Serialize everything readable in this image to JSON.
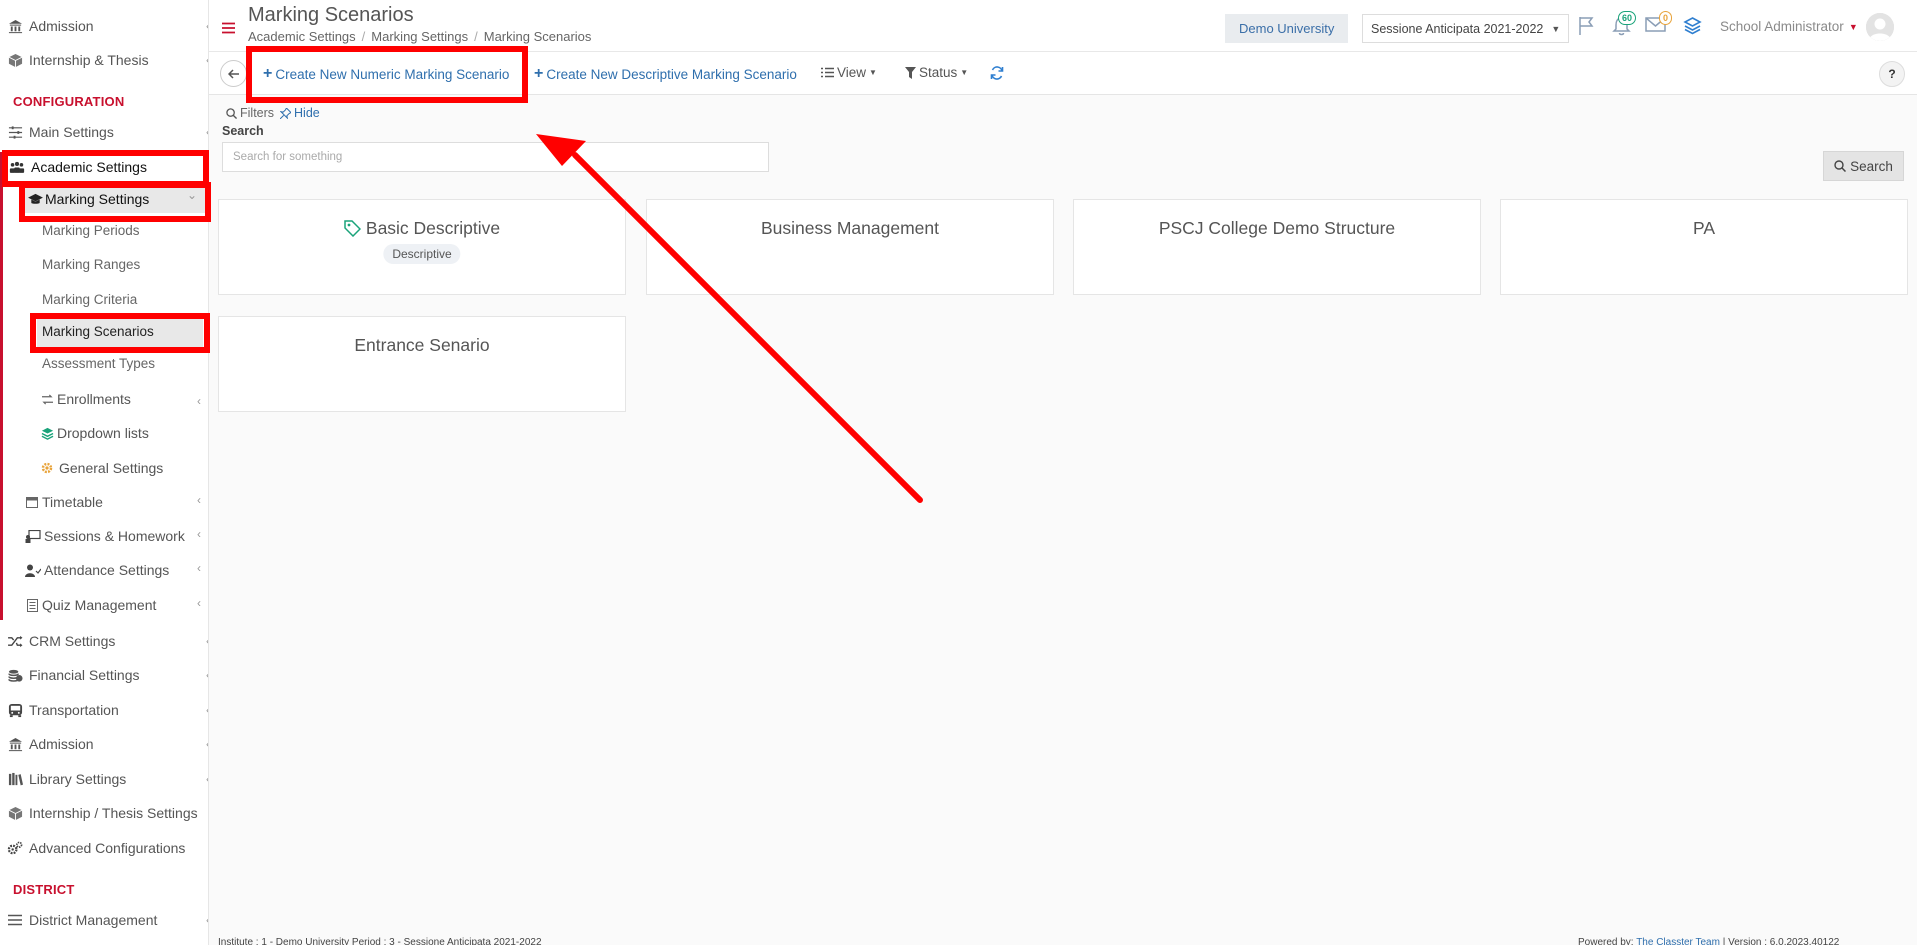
{
  "sidebar": {
    "top_items": [
      "Admission",
      "Internship & Thesis"
    ],
    "section_configuration": "CONFIGURATION",
    "main_settings": "Main Settings",
    "academic_settings": "Academic Settings",
    "marking_settings": "Marking Settings",
    "marking_sub": [
      "Marking Periods",
      "Marking Ranges",
      "Marking Criteria",
      "Marking Scenarios",
      "Assessment Types"
    ],
    "academic_sub": [
      "Enrollments",
      "Dropdown lists",
      "General Settings"
    ],
    "academic_more": [
      "Timetable",
      "Sessions & Homework",
      "Attendance Settings",
      "Quiz Management"
    ],
    "config_items": [
      "CRM Settings",
      "Financial Settings",
      "Transportation",
      "Admission",
      "Library Settings",
      "Internship / Thesis Settings",
      "Advanced Configurations"
    ],
    "section_district": "DISTRICT",
    "district_management": "District Management"
  },
  "header": {
    "title": "Marking Scenarios",
    "breadcrumb": [
      "Academic Settings",
      "Marking Settings",
      "Marking Scenarios"
    ],
    "university": "Demo University",
    "session": "Sessione Anticipata 2021-2022",
    "notifications_count": "60",
    "messages_count": "0",
    "user": "School Administrator"
  },
  "toolbar": {
    "create_numeric": "Create New Numeric Marking Scenario",
    "create_descriptive": "Create New Descriptive Marking Scenario",
    "view": "View",
    "status": "Status",
    "help": "?"
  },
  "filters": {
    "label": "Filters",
    "hide": "Hide",
    "search_label": "Search",
    "search_placeholder": "Search for something",
    "search_button": "Search"
  },
  "cards": [
    {
      "title": "Basic Descriptive",
      "tag": "Descriptive"
    },
    {
      "title": "Business Management",
      "tag": ""
    },
    {
      "title": "PSCJ College Demo Structure",
      "tag": ""
    },
    {
      "title": "PA",
      "tag": ""
    },
    {
      "title": "Entrance Senario",
      "tag": ""
    }
  ],
  "footer": {
    "left": "Institute : 1 - Demo University Period : 3 - Sessione Anticipata 2021-2022",
    "powered_by": "Powered by:",
    "team": "The Classter Team",
    "version": "| Version : 6.0.2023.40122"
  },
  "colors": {
    "accent": "#c8102e",
    "link": "#2f6fad",
    "annotation": "#ff0000"
  }
}
